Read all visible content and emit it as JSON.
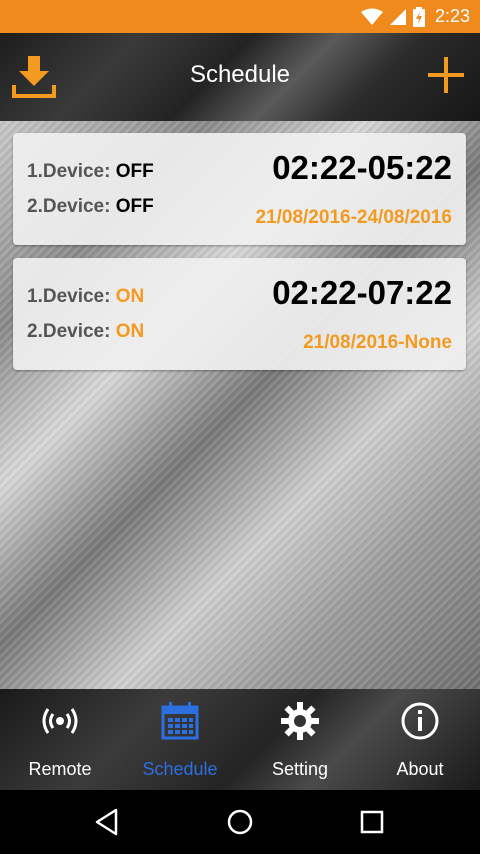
{
  "status_bar": {
    "time": "2:23"
  },
  "app_bar": {
    "title": "Schedule"
  },
  "schedules": [
    {
      "device1_label": "1.Device:",
      "device1_state": "OFF",
      "device2_label": "2.Device:",
      "device2_state": "OFF",
      "time_range": "02:22-05:22",
      "date_range": "21/08/2016-24/08/2016"
    },
    {
      "device1_label": "1.Device:",
      "device1_state": "ON",
      "device2_label": "2.Device:",
      "device2_state": "ON",
      "time_range": "02:22-07:22",
      "date_range": "21/08/2016-None"
    }
  ],
  "bottom_nav": {
    "items": [
      {
        "label": "Remote",
        "icon": "broadcast-icon"
      },
      {
        "label": "Schedule",
        "icon": "calendar-icon",
        "active": true
      },
      {
        "label": "Setting",
        "icon": "gear-icon"
      },
      {
        "label": "About",
        "icon": "info-icon"
      }
    ]
  },
  "colors": {
    "status_bar": "#f08a1c",
    "accent_orange": "#f39a20",
    "active_blue": "#2b6fe0"
  }
}
